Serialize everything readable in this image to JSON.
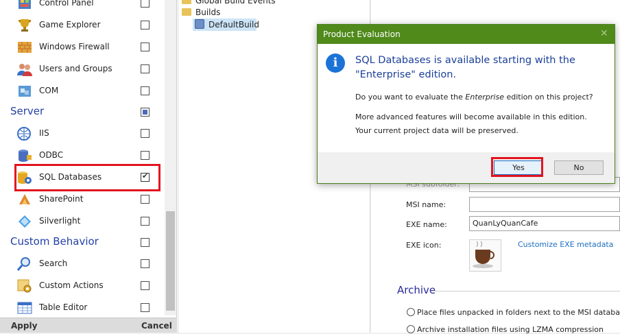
{
  "features": {
    "rows_top": [
      {
        "label": "Control Panel",
        "icon": "control-panel-icon"
      },
      {
        "label": "Game Explorer",
        "icon": "trophy-icon"
      },
      {
        "label": "Windows Firewall",
        "icon": "firewall-icon"
      },
      {
        "label": "Users and Groups",
        "icon": "users-icon"
      },
      {
        "label": "COM",
        "icon": "com-icon"
      }
    ],
    "server_section": "Server",
    "server_rows": [
      {
        "label": "IIS",
        "icon": "iis-icon"
      },
      {
        "label": "ODBC",
        "icon": "odbc-icon"
      },
      {
        "label": "SQL Databases",
        "icon": "database-icon"
      },
      {
        "label": "SharePoint",
        "icon": "sharepoint-icon"
      },
      {
        "label": "Silverlight",
        "icon": "silverlight-icon"
      }
    ],
    "custom_section": "Custom Behavior",
    "custom_rows": [
      {
        "label": "Search",
        "icon": "search-icon"
      },
      {
        "label": "Custom Actions",
        "icon": "custom-actions-icon"
      },
      {
        "label": "Table Editor",
        "icon": "table-editor-icon"
      }
    ],
    "apply_label": "Apply",
    "cancel_label": "Cancel"
  },
  "tree": {
    "global_build_events": "Global Build Events",
    "builds": "Builds",
    "default_build": "DefaultBuild"
  },
  "properties": {
    "msi_subfolder_label": "MSI subfolder:",
    "msi_name_label": "MSI name:",
    "msi_name_value": "",
    "exe_name_label": "EXE name:",
    "exe_name_value": "QuanLyQuanCafe",
    "exe_icon_label": "EXE icon:",
    "customize_link": "Customize EXE metadata",
    "archive_title": "Archive",
    "archive_option_1": "Place files unpacked in folders next to the MSI database",
    "archive_option_2": "Archive installation files using LZMA compression"
  },
  "dialog": {
    "title": "Product Evaluation",
    "close_glyph": "✕",
    "info_glyph": "i",
    "heading": "SQL Databases is available starting with the \"Enterprise\" edition.",
    "question_prefix": "Do you want to evaluate the ",
    "question_edition": "Enterprise",
    "question_suffix": " edition on this project?",
    "line_1": "More advanced features will become available in this edition.",
    "line_2": "Your current project data will be preserved.",
    "yes_label": "Yes",
    "no_label": "No"
  },
  "colors": {
    "dialog_titlebar": "#4f8a1b",
    "section_text": "#2440a8",
    "highlight": "#e2141e",
    "link": "#1c6fbf"
  }
}
